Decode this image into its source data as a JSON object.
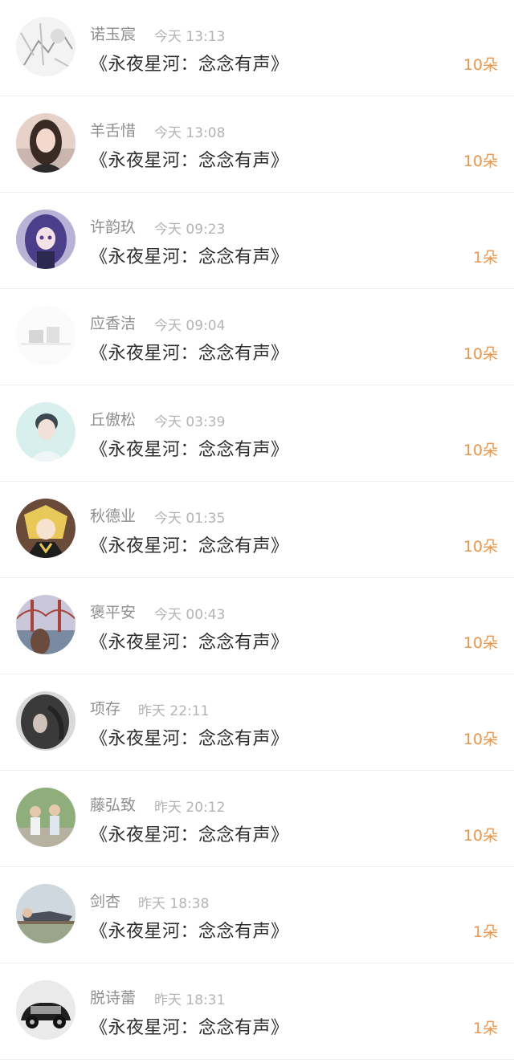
{
  "records": [
    {
      "name": "诺玉宸",
      "time": "今天 13:13",
      "work": "《永夜星河：念念有声》",
      "gift": "10朵",
      "avatar_icon": "avatar-lineart-icon"
    },
    {
      "name": "羊舌惜",
      "time": "今天 13:08",
      "work": "《永夜星河：念念有声》",
      "gift": "10朵",
      "avatar_icon": "avatar-girl-portrait-icon"
    },
    {
      "name": "许韵玖",
      "time": "今天 09:23",
      "work": "《永夜星河：念念有声》",
      "gift": "1朵",
      "avatar_icon": "avatar-anime-purple-icon"
    },
    {
      "name": "应香洁",
      "time": "今天 09:04",
      "work": "《永夜星河：念念有声》",
      "gift": "10朵",
      "avatar_icon": "avatar-faded-icon"
    },
    {
      "name": "丘傲松",
      "time": "今天 03:39",
      "work": "《永夜星河：念念有声》",
      "gift": "10朵",
      "avatar_icon": "avatar-boy-mint-icon"
    },
    {
      "name": "秋德业",
      "time": "今天 01:35",
      "work": "《永夜星河：念念有声》",
      "gift": "10朵",
      "avatar_icon": "avatar-anime-blonde-icon"
    },
    {
      "name": "褒平安",
      "time": "今天 00:43",
      "work": "《永夜星河：念念有声》",
      "gift": "10朵",
      "avatar_icon": "avatar-bridge-sunset-icon"
    },
    {
      "name": "项存",
      "time": "昨天 22:11",
      "work": "《永夜星河：念念有声》",
      "gift": "10朵",
      "avatar_icon": "avatar-dark-hair-icon"
    },
    {
      "name": "藤弘致",
      "time": "昨天 20:12",
      "work": "《永夜星河：念念有声》",
      "gift": "10朵",
      "avatar_icon": "avatar-two-kids-icon"
    },
    {
      "name": "剑杏",
      "time": "昨天 18:38",
      "work": "《永夜星河：念念有声》",
      "gift": "1朵",
      "avatar_icon": "avatar-lying-outdoor-icon"
    },
    {
      "name": "脱诗蕾",
      "time": "昨天 18:31",
      "work": "《永夜星河：念念有声》",
      "gift": "1朵",
      "avatar_icon": "avatar-classic-car-icon"
    }
  ]
}
